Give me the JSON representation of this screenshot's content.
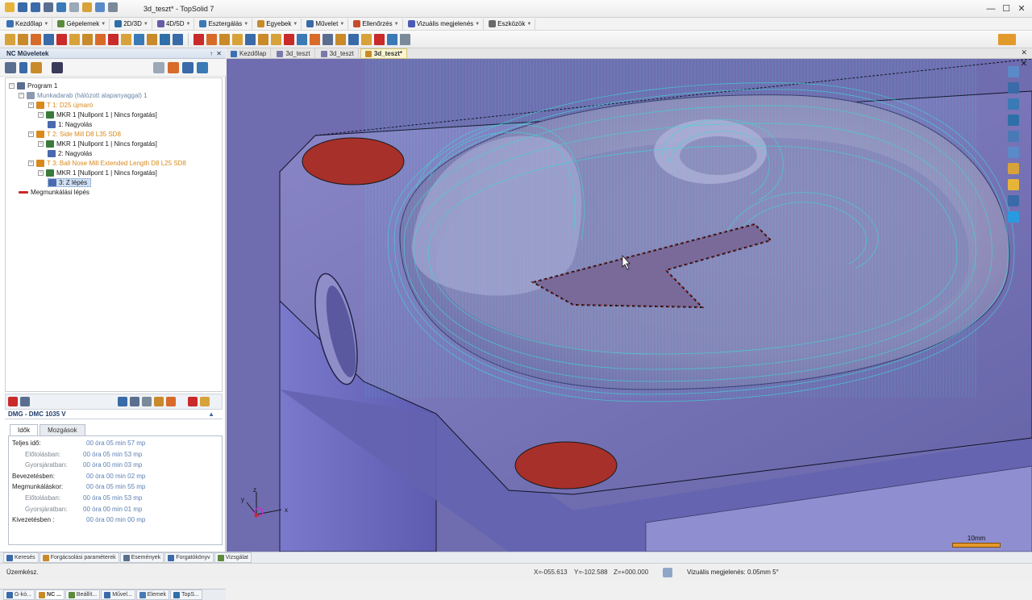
{
  "window": {
    "title": "3d_teszt* - TopSolid 7",
    "minimize": "—",
    "maximize": "☐",
    "close": "✕"
  },
  "menubar": {
    "items": [
      {
        "label": "Kezdőlap",
        "icon": "home-icon",
        "color": "#3b6fb6"
      },
      {
        "label": "Gépelemek",
        "icon": "machine-elements-icon",
        "color": "#5a8a3a"
      },
      {
        "label": "2D/3D",
        "icon": "2d3d-icon",
        "color": "#2e6fa8"
      },
      {
        "label": "4D/5D",
        "icon": "4d5d-icon",
        "color": "#6a5aa8"
      },
      {
        "label": "Esztergálás",
        "icon": "turning-icon",
        "color": "#3a7ab6"
      },
      {
        "label": "Egyebek",
        "icon": "misc-icon",
        "color": "#c98a2a"
      },
      {
        "label": "Művelet",
        "icon": "operation-icon",
        "color": "#3a6aa8"
      },
      {
        "label": "Ellenőrzés",
        "icon": "check-icon",
        "color": "#c94a2a"
      },
      {
        "label": "Vizuális megjelenés",
        "icon": "visual-icon",
        "color": "#4a5ab6"
      },
      {
        "label": "Eszközök",
        "icon": "tools-icon",
        "color": "#6a6a6a"
      }
    ]
  },
  "nc_panel": {
    "title": "NC Műveletek",
    "pin": "↑",
    "close": "✕",
    "tree": [
      {
        "id": "program",
        "label": "Program 1",
        "indent": 0,
        "expand": "−",
        "icon_color": "#5a6f8f"
      },
      {
        "id": "workpiece",
        "label": "Munkadarab (hálózott alapanyaggal) 1",
        "indent": 1,
        "expand": "−",
        "icon_color": "#8a9ab0",
        "style": "grey"
      },
      {
        "id": "tool1",
        "label": "T 1: D25 újmaró",
        "indent": 2,
        "expand": "−",
        "icon_color": "#d88a1c",
        "style": "tool"
      },
      {
        "id": "mkr1a",
        "label": "MKR 1 [Nullpont 1 | Nincs forgatás]",
        "indent": 3,
        "expand": "−",
        "icon_color": "#3a7a3a"
      },
      {
        "id": "op1",
        "label": "1: Nagyolás",
        "indent": 4,
        "icon_color": "#4a6ab0"
      },
      {
        "id": "tool2",
        "label": "T 2: Side Mill D8 L35 SD8",
        "indent": 2,
        "expand": "−",
        "icon_color": "#d88a1c",
        "style": "tool"
      },
      {
        "id": "mkr1b",
        "label": "MKR 1 [Nullpont 1 | Nincs forgatás]",
        "indent": 3,
        "expand": "−",
        "icon_color": "#3a7a3a"
      },
      {
        "id": "op2",
        "label": "2: Nagyolás",
        "indent": 4,
        "icon_color": "#4a6ab0"
      },
      {
        "id": "tool3",
        "label": "T 3: Ball Nose Mill Extended Length D8 L25 SD8",
        "indent": 2,
        "expand": "−",
        "icon_color": "#d88a1c",
        "style": "tool"
      },
      {
        "id": "mkr1c",
        "label": "MKR 1 [Nullpont 1 | Nincs forgatás]",
        "indent": 3,
        "expand": "−",
        "icon_color": "#3a7a3a"
      },
      {
        "id": "op3",
        "label": "3: Z lépés",
        "indent": 4,
        "icon_color": "#4a6ab0",
        "selected": true
      },
      {
        "id": "step",
        "label": "Megmunkálási lépés",
        "indent": 1,
        "icon_color": "#c92a2a",
        "arrow": true
      }
    ],
    "machine": "DMG - DMC 1035 V",
    "machine_arrow": "▲",
    "tabs": [
      "Idők",
      "Mozgások"
    ],
    "times": [
      {
        "label": "Teljes idő:",
        "value": "00 óra 05 min 57 mp",
        "sub": false
      },
      {
        "label": "Előtolásban:",
        "value": "00 óra 05 min 53 mp",
        "sub": true
      },
      {
        "label": "Gyorsjáratban:",
        "value": "00 óra 00 min 03 mp",
        "sub": true
      },
      {
        "label": "Bevezetésben:",
        "value": "00 óra 00 min 02 mp",
        "sub": false
      },
      {
        "label": "Megmunkáláskor:",
        "value": "00 óra 05 min 55 mp",
        "sub": false
      },
      {
        "label": "Előtolásban:",
        "value": "00 óra 05 min 53 mp",
        "sub": true
      },
      {
        "label": "Gyorsjáratban:",
        "value": "00 óra 00 min 01 mp",
        "sub": true
      },
      {
        "label": "Kivezetésben :",
        "value": "00 óra 00 min 00 mp",
        "sub": false
      }
    ],
    "bottom_tabs": [
      {
        "label": "G-kó...",
        "icon_color": "#3a6aa8"
      },
      {
        "label": "NC ...",
        "icon_color": "#c98a2a",
        "active": true
      },
      {
        "label": "Beállít...",
        "icon_color": "#5a8a3a"
      },
      {
        "label": "Művel...",
        "icon_color": "#3a6aa8"
      },
      {
        "label": "Elemek",
        "icon_color": "#4a7ab6"
      },
      {
        "label": "TopS...",
        "icon_color": "#2e6fa8"
      }
    ]
  },
  "doc_tabs": [
    {
      "label": "Kezdőlap",
      "icon_color": "#3b6fb6"
    },
    {
      "label": "3d_teszt",
      "icon_color": "#7a7aaa"
    },
    {
      "label": "3d_teszt",
      "icon_color": "#7a7aaa"
    },
    {
      "label": "3d_teszt*",
      "icon_color": "#c98a2a",
      "active": true
    }
  ],
  "doc_close": "✕",
  "viewport": {
    "close": "✕",
    "scale_label": "10mm",
    "axis_x": "x",
    "axis_y": "y",
    "axis_z": "z",
    "colors": {
      "part": "#7675c0",
      "toolpath": "#3fd6d6",
      "hole": "#a8302a"
    }
  },
  "bottom_tabs": [
    {
      "label": "Keresés",
      "icon_color": "#3a6aa8"
    },
    {
      "label": "Forgácsolási paraméterek",
      "icon_color": "#c98a2a"
    },
    {
      "label": "Események",
      "icon_color": "#5a6f8f"
    },
    {
      "label": "Forgatókönyv",
      "icon_color": "#3a6aa8"
    },
    {
      "label": "Vizsgálat",
      "icon_color": "#5a8a3a"
    }
  ],
  "status": {
    "mode": "Üzemkész.",
    "x": "X=-055.613",
    "y": "Y=-102.588",
    "z": "Z=+000.000",
    "visual": "Vizuális megjelenés: 0.05mm 5°"
  }
}
